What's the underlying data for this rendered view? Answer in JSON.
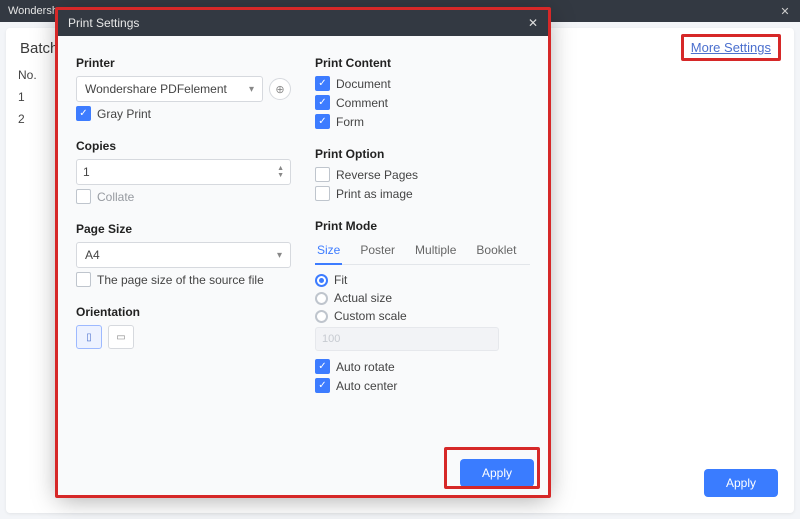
{
  "app": {
    "title": "Wondersha"
  },
  "bg": {
    "title": "Batch",
    "col_no": "No.",
    "rows": [
      "1",
      "2"
    ],
    "more_settings": "More Settings",
    "apply": "Apply"
  },
  "modal": {
    "title": "Print Settings",
    "left": {
      "printer_label": "Printer",
      "printer_selected": "Wondershare PDFelement",
      "gray_print": "Gray Print",
      "copies_label": "Copies",
      "copies_value": "1",
      "collate": "Collate",
      "page_size_label": "Page Size",
      "page_size_value": "A4",
      "src_page_size": "The page size of the source file",
      "orientation_label": "Orientation"
    },
    "right": {
      "content_label": "Print Content",
      "content": {
        "document": "Document",
        "comment": "Comment",
        "form": "Form"
      },
      "option_label": "Print Option",
      "option": {
        "reverse": "Reverse Pages",
        "asimg": "Print as image"
      },
      "mode_label": "Print Mode",
      "tabs": {
        "size": "Size",
        "poster": "Poster",
        "multiple": "Multiple",
        "booklet": "Booklet"
      },
      "size_opts": {
        "fit": "Fit",
        "actual": "Actual size",
        "custom": "Custom scale",
        "scale_value": "100"
      },
      "auto_rotate": "Auto rotate",
      "auto_center": "Auto center"
    },
    "apply": "Apply"
  }
}
